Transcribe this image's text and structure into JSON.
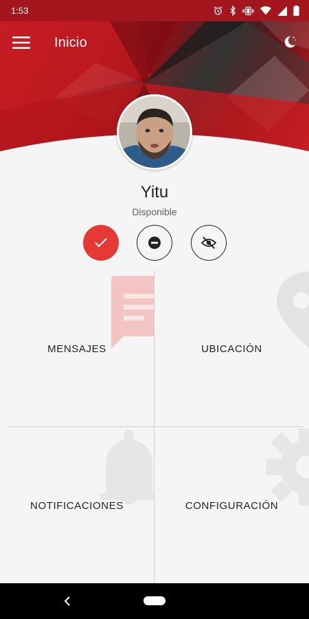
{
  "status_bar": {
    "time": "1:53",
    "icons": [
      "alarm-icon",
      "bluetooth-icon",
      "vibrate-icon",
      "wifi-icon",
      "signal-icon",
      "battery-icon"
    ]
  },
  "header": {
    "title": "Inicio",
    "menu_icon": "hamburger-menu-icon",
    "action_icon": "night-mode-icon"
  },
  "profile": {
    "name": "Yitu",
    "status": "Disponible"
  },
  "status_options": [
    {
      "name": "available",
      "icon": "check-icon",
      "active": true
    },
    {
      "name": "busy",
      "icon": "do-not-disturb-icon",
      "active": false
    },
    {
      "name": "invisible",
      "icon": "eye-off-icon",
      "active": false
    }
  ],
  "tiles": {
    "messages": "MENSAJES",
    "location": "UBICACIÓN",
    "notifications": "NOTIFICACIONES",
    "settings": "CONFIGURACIÓN"
  },
  "colors": {
    "accent": "#e53935",
    "header_dark": "#2b2b2b",
    "background": "#f5f5f5"
  }
}
